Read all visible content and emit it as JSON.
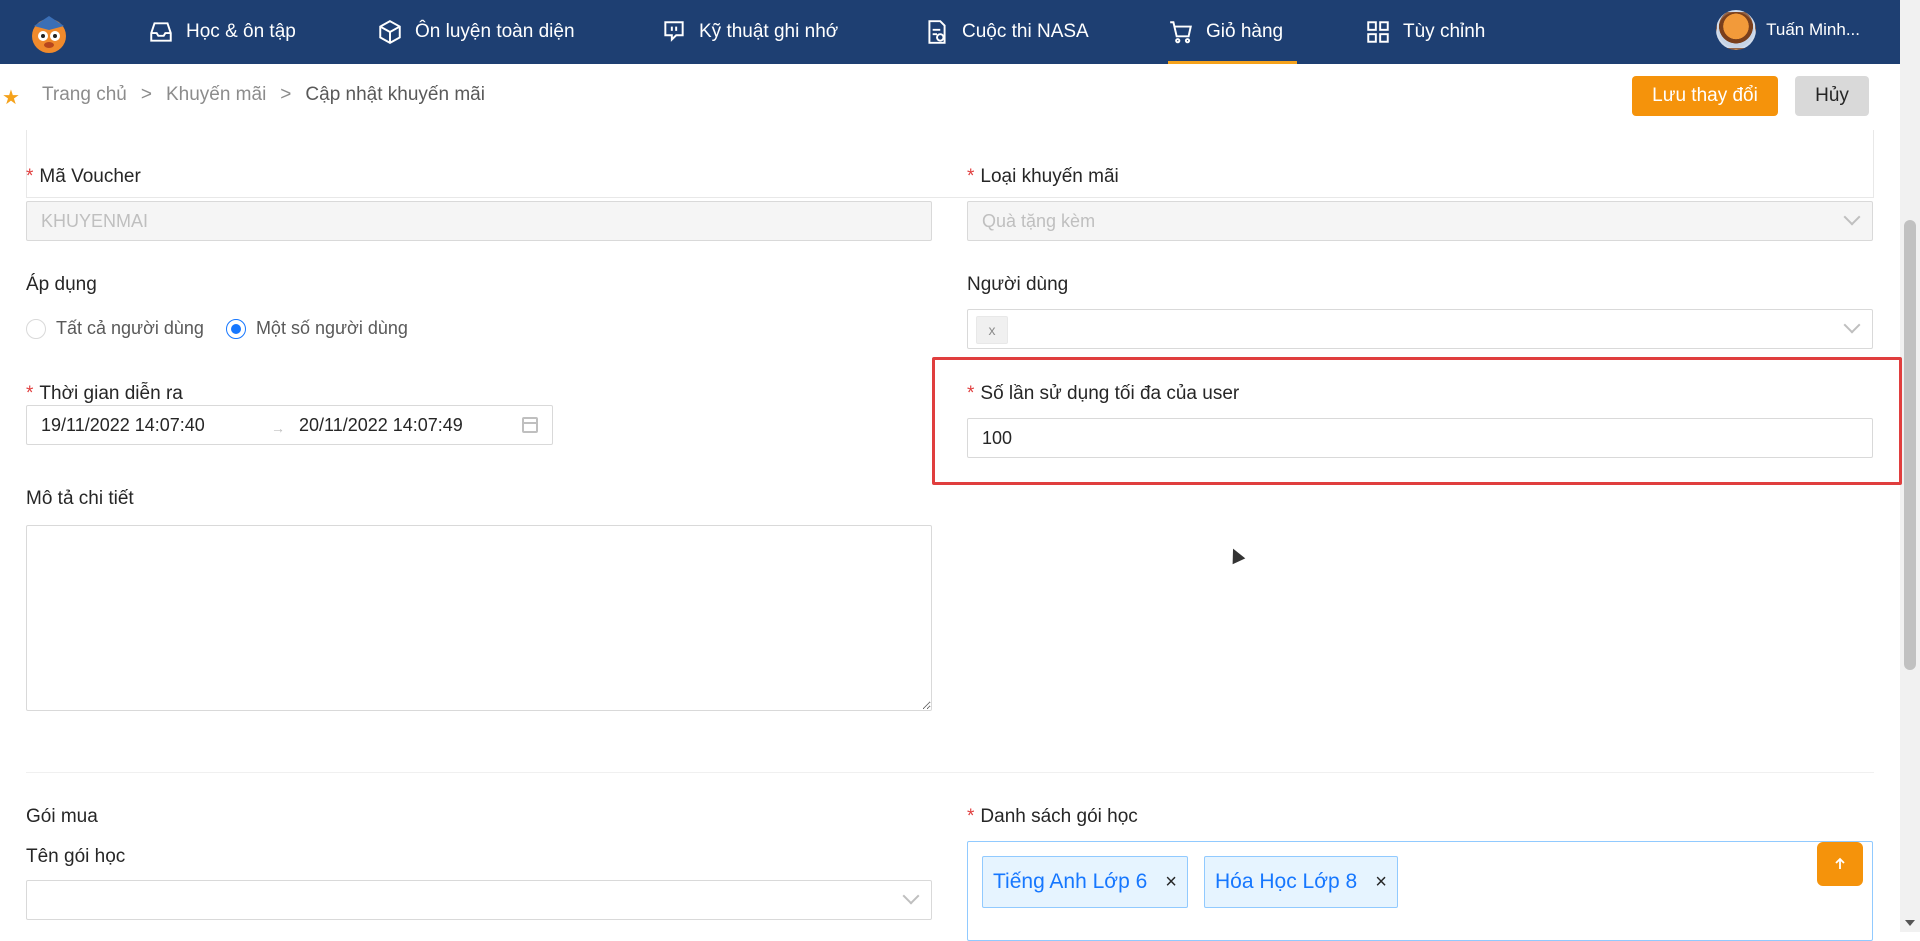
{
  "nav": {
    "items": [
      {
        "label": "Học & ôn tập",
        "icon": "inbox-icon"
      },
      {
        "label": "Ôn luyện toàn diện",
        "icon": "box-icon"
      },
      {
        "label": "Kỹ thuật ghi nhớ",
        "icon": "chat-icon"
      },
      {
        "label": "Cuộc thi NASA",
        "icon": "document-check-icon"
      },
      {
        "label": "Giỏ hàng",
        "icon": "cart-icon",
        "active": true
      },
      {
        "label": "Tùy chỉnh",
        "icon": "grid-icon"
      }
    ],
    "user_name": "Tuấn Minh..."
  },
  "breadcrumb": {
    "items": [
      "Trang chủ",
      "Khuyến mãi",
      "Cập nhật khuyến mãi"
    ],
    "separator": ">"
  },
  "actions": {
    "save": "Lưu thay đổi",
    "cancel": "Hủy"
  },
  "form": {
    "voucher": {
      "label": "Mã Voucher",
      "value": "KHUYENMAI"
    },
    "promo_type": {
      "label": "Loại khuyến mãi",
      "value": "Quà tặng kèm"
    },
    "apply": {
      "label": "Áp dụng",
      "options": [
        "Tất cả người dùng",
        "Một số người dùng"
      ],
      "selected": "Một số người dùng"
    },
    "users": {
      "label": "Người dùng",
      "tag_remove": "x"
    },
    "period": {
      "label": "Thời gian diễn ra",
      "start": "19/11/2022 14:07:40",
      "end": "20/11/2022 14:07:49",
      "separator": "→"
    },
    "max_uses": {
      "label": "Số lần sử dụng tối đa của user",
      "value": "100"
    },
    "description": {
      "label": "Mô tả chi tiết",
      "value": ""
    },
    "purchase": {
      "label": "Gói mua"
    },
    "package_name": {
      "label": "Tên gói học",
      "value": ""
    },
    "package_list": {
      "label": "Danh sách gói học",
      "tags": [
        "Tiếng Anh Lớp 6",
        "Hóa Học Lớp 8"
      ],
      "remove_symbol": "×"
    }
  },
  "colors": {
    "nav_bg": "#1e3f72",
    "accent": "#f5930b",
    "required": "#e03e3e",
    "highlight_border": "#e03e3e",
    "tag_blue": "#1677ff"
  }
}
